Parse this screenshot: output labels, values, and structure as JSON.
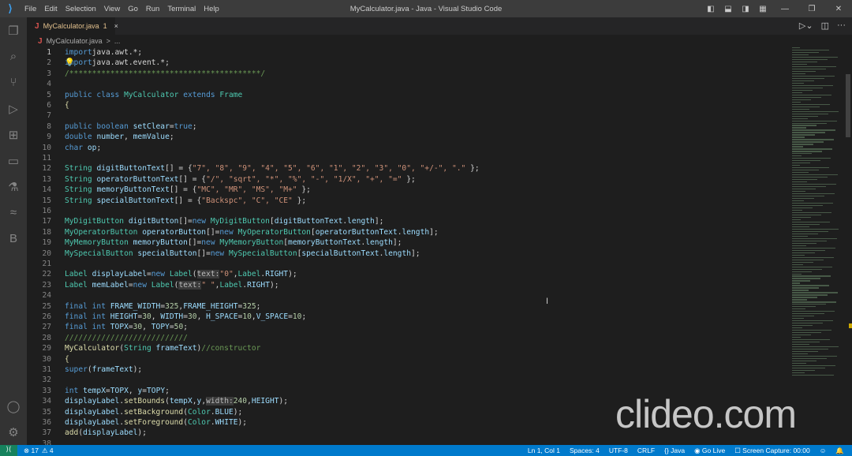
{
  "titlebar": {
    "menu": [
      "File",
      "Edit",
      "Selection",
      "View",
      "Go",
      "Run",
      "Terminal",
      "Help"
    ],
    "title": "MyCalculator.java - Java - Visual Studio Code"
  },
  "tab": {
    "icon": "J",
    "label": "MyCalculator.java",
    "problems": "1",
    "close": "×"
  },
  "breadcrumb": {
    "icon": "J",
    "file": "MyCalculator.java",
    "sep": ">",
    "more": "..."
  },
  "activity": [
    "explorer-icon",
    "search-icon",
    "source-control-icon",
    "run-debug-icon",
    "extensions-icon",
    "remote-explorer-icon",
    "testing-icon",
    "java-icon",
    "b-icon"
  ],
  "code": [
    [
      [
        "kw",
        "import"
      ],
      [
        "",
        "java.awt.*;"
      ]
    ],
    [
      [
        "kw",
        "import"
      ],
      [
        "",
        "java.awt.event.*;"
      ]
    ],
    [
      [
        "co",
        "/******************************************/"
      ]
    ],
    [],
    [
      [
        "kw",
        "public class "
      ],
      [
        "ty",
        "MyCalculator "
      ],
      [
        "kw",
        "extends "
      ],
      [
        "ty",
        "Frame"
      ]
    ],
    [
      [
        "fn",
        "{"
      ]
    ],
    [],
    [
      [
        "kw",
        "public boolean "
      ],
      [
        "va",
        "setClear"
      ],
      [
        "",
        "="
      ],
      [
        "kw",
        "true"
      ],
      [
        "",
        ";"
      ]
    ],
    [
      [
        "kw",
        "double "
      ],
      [
        "va",
        "number"
      ],
      [
        "",
        ", "
      ],
      [
        "va",
        "memValue"
      ],
      [
        "",
        ";"
      ]
    ],
    [
      [
        "kw",
        "char "
      ],
      [
        "va",
        "op"
      ],
      [
        "",
        ";"
      ]
    ],
    [],
    [
      [
        "ty",
        "String "
      ],
      [
        "va",
        "digitButtonText"
      ],
      [
        "",
        "[] = {"
      ],
      [
        "st",
        "\"7\", \"8\", \"9\", \"4\", \"5\", \"6\", \"1\", \"2\", \"3\", \"0\", \"+/-\", \".\""
      ],
      [
        "",
        " };"
      ]
    ],
    [
      [
        "ty",
        "String "
      ],
      [
        "va",
        "operatorButtonText"
      ],
      [
        "",
        "[] = {"
      ],
      [
        "st",
        "\"/\", \"sqrt\", \"*\", \"%\", \"-\", \"1/X\", \"+\", \"=\""
      ],
      [
        "",
        " };"
      ]
    ],
    [
      [
        "ty",
        "String "
      ],
      [
        "va",
        "memoryButtonText"
      ],
      [
        "",
        "[] = {"
      ],
      [
        "st",
        "\"MC\", \"MR\", \"MS\", \"M+\""
      ],
      [
        "",
        " };"
      ]
    ],
    [
      [
        "ty",
        "String "
      ],
      [
        "va",
        "specialButtonText"
      ],
      [
        "",
        "[] = {"
      ],
      [
        "st",
        "\"Backspc\", \"C\", \"CE\""
      ],
      [
        "",
        " };"
      ]
    ],
    [],
    [
      [
        "ty",
        "MyDigitButton "
      ],
      [
        "va",
        "digitButton"
      ],
      [
        "",
        "[]="
      ],
      [
        "kw",
        "new "
      ],
      [
        "ty",
        "MyDigitButton"
      ],
      [
        "",
        "["
      ],
      [
        "va",
        "digitButtonText"
      ],
      [
        "",
        "."
      ],
      [
        "va",
        "length"
      ],
      [
        "",
        "];"
      ]
    ],
    [
      [
        "ty",
        "MyOperatorButton "
      ],
      [
        "va",
        "operatorButton"
      ],
      [
        "",
        "[]="
      ],
      [
        "kw",
        "new "
      ],
      [
        "ty",
        "MyOperatorButton"
      ],
      [
        "",
        "["
      ],
      [
        "va",
        "operatorButtonText"
      ],
      [
        "",
        "."
      ],
      [
        "va",
        "length"
      ],
      [
        "",
        "];"
      ]
    ],
    [
      [
        "ty",
        "MyMemoryButton "
      ],
      [
        "va",
        "memoryButton"
      ],
      [
        "",
        "[]="
      ],
      [
        "kw",
        "new "
      ],
      [
        "ty",
        "MyMemoryButton"
      ],
      [
        "",
        "["
      ],
      [
        "va",
        "memoryButtonText"
      ],
      [
        "",
        "."
      ],
      [
        "va",
        "length"
      ],
      [
        "",
        "];"
      ]
    ],
    [
      [
        "ty",
        "MySpecialButton "
      ],
      [
        "va",
        "specialButton"
      ],
      [
        "",
        "[]="
      ],
      [
        "kw",
        "new "
      ],
      [
        "ty",
        "MySpecialButton"
      ],
      [
        "",
        "["
      ],
      [
        "va",
        "specialButtonText"
      ],
      [
        "",
        "."
      ],
      [
        "va",
        "length"
      ],
      [
        "",
        "];"
      ]
    ],
    [],
    [
      [
        "ty",
        "Label "
      ],
      [
        "va",
        "displayLabel"
      ],
      [
        "",
        "="
      ],
      [
        "kw",
        "new "
      ],
      [
        "ty",
        "Label"
      ],
      [
        "",
        "("
      ],
      [
        "hint",
        "text:"
      ],
      [
        "st",
        "\"0\""
      ],
      [
        "",
        ","
      ],
      [
        "ty",
        "Label"
      ],
      [
        "",
        "."
      ],
      [
        "va",
        "RIGHT"
      ],
      [
        "",
        ");"
      ]
    ],
    [
      [
        "ty",
        "Label "
      ],
      [
        "va",
        "memLabel"
      ],
      [
        "",
        "="
      ],
      [
        "kw",
        "new "
      ],
      [
        "ty",
        "Label"
      ],
      [
        "",
        "("
      ],
      [
        "hint",
        "text:"
      ],
      [
        "st",
        "\" \""
      ],
      [
        "",
        ","
      ],
      [
        "ty",
        "Label"
      ],
      [
        "",
        "."
      ],
      [
        "va",
        "RIGHT"
      ],
      [
        "",
        ");"
      ]
    ],
    [],
    [
      [
        "kw",
        "final int "
      ],
      [
        "va",
        "FRAME_WIDTH"
      ],
      [
        "",
        "="
      ],
      [
        "nu",
        "325"
      ],
      [
        "",
        ","
      ],
      [
        "va",
        "FRAME_HEIGHT"
      ],
      [
        "",
        "="
      ],
      [
        "nu",
        "325"
      ],
      [
        "",
        ";"
      ]
    ],
    [
      [
        "kw",
        "final int "
      ],
      [
        "va",
        "HEIGHT"
      ],
      [
        "",
        "="
      ],
      [
        "nu",
        "30"
      ],
      [
        "",
        ", "
      ],
      [
        "va",
        "WIDTH"
      ],
      [
        "",
        "="
      ],
      [
        "nu",
        "30"
      ],
      [
        "",
        ", "
      ],
      [
        "va",
        "H_SPACE"
      ],
      [
        "",
        "="
      ],
      [
        "nu",
        "10"
      ],
      [
        "",
        ","
      ],
      [
        "va",
        "V_SPACE"
      ],
      [
        "",
        "="
      ],
      [
        "nu",
        "10"
      ],
      [
        "",
        ";"
      ]
    ],
    [
      [
        "kw",
        "final int "
      ],
      [
        "va",
        "TOPX"
      ],
      [
        "",
        "="
      ],
      [
        "nu",
        "30"
      ],
      [
        "",
        ", "
      ],
      [
        "va",
        "TOPY"
      ],
      [
        "",
        "="
      ],
      [
        "nu",
        "50"
      ],
      [
        "",
        ";"
      ]
    ],
    [
      [
        "co",
        "///////////////////////////"
      ]
    ],
    [
      [
        "fn",
        "MyCalculator"
      ],
      [
        "",
        "("
      ],
      [
        "ty",
        "String "
      ],
      [
        "va",
        "frameText"
      ],
      [
        "",
        ")"
      ],
      [
        "co",
        "//constructor"
      ]
    ],
    [
      [
        "fn",
        "{"
      ]
    ],
    [
      [
        "kw",
        "super"
      ],
      [
        "",
        "("
      ],
      [
        "va",
        "frameText"
      ],
      [
        "",
        ");"
      ]
    ],
    [],
    [
      [
        "kw",
        "int "
      ],
      [
        "va",
        "tempX"
      ],
      [
        "",
        "="
      ],
      [
        "va",
        "TOPX"
      ],
      [
        "",
        ", "
      ],
      [
        "va",
        "y"
      ],
      [
        "",
        "="
      ],
      [
        "va",
        "TOPY"
      ],
      [
        "",
        ";"
      ]
    ],
    [
      [
        "va",
        "displayLabel"
      ],
      [
        "",
        "."
      ],
      [
        "fn",
        "setBounds"
      ],
      [
        "",
        "("
      ],
      [
        "va",
        "tempX"
      ],
      [
        "",
        ","
      ],
      [
        "va",
        "y"
      ],
      [
        "",
        ","
      ],
      [
        "hint",
        "width:"
      ],
      [
        "nu",
        "240"
      ],
      [
        "",
        ","
      ],
      [
        "va",
        "HEIGHT"
      ],
      [
        "",
        ");"
      ]
    ],
    [
      [
        "va",
        "displayLabel"
      ],
      [
        "",
        "."
      ],
      [
        "fn",
        "setBackground"
      ],
      [
        "",
        "("
      ],
      [
        "ty",
        "Color"
      ],
      [
        "",
        "."
      ],
      [
        "va",
        "BLUE"
      ],
      [
        "",
        ");"
      ]
    ],
    [
      [
        "va",
        "displayLabel"
      ],
      [
        "",
        "."
      ],
      [
        "fn",
        "setForeground"
      ],
      [
        "",
        "("
      ],
      [
        "ty",
        "Color"
      ],
      [
        "",
        "."
      ],
      [
        "va",
        "WHITE"
      ],
      [
        "",
        ");"
      ]
    ],
    [
      [
        "fn",
        "add"
      ],
      [
        "",
        "("
      ],
      [
        "va",
        "displayLabel"
      ],
      [
        "",
        ");"
      ]
    ],
    []
  ],
  "status": {
    "remote": "⟩⟨",
    "errors": "⊗ 17",
    "warnings": "⚠ 4",
    "position": "Ln 1, Col 1",
    "spaces": "Spaces: 4",
    "encoding": "UTF-8",
    "eol": "CRLF",
    "language": "{} Java",
    "golive": "◉ Go Live",
    "capture": "☐ Screen Capture: 00:00",
    "feedback": "☺",
    "bell": "🔔"
  },
  "watermark": "clideo.com"
}
